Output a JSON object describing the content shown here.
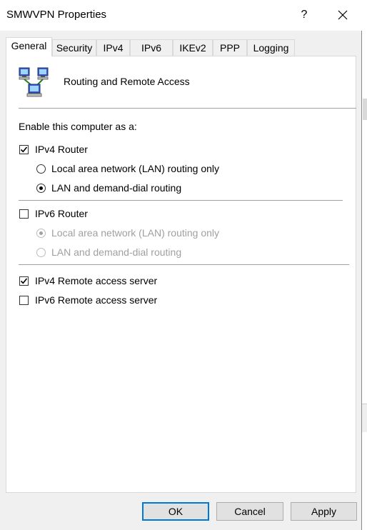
{
  "window": {
    "title": "SMWVPN Properties",
    "help_label": "?"
  },
  "tabs": [
    {
      "label": "General"
    },
    {
      "label": "Security"
    },
    {
      "label": "IPv4"
    },
    {
      "label": "IPv6"
    },
    {
      "label": "IKEv2"
    },
    {
      "label": "PPP"
    },
    {
      "label": "Logging"
    }
  ],
  "active_tab": "General",
  "general": {
    "app_icon": "network-computers-icon",
    "heading": "Routing and Remote Access",
    "enable_label": "Enable this computer as a:",
    "ipv4_router": {
      "label": "IPv4 Router",
      "checked": true,
      "options": [
        {
          "label": "Local area network (LAN) routing only",
          "selected": false
        },
        {
          "label": "LAN and demand-dial routing",
          "selected": true
        }
      ]
    },
    "ipv6_router": {
      "label": "IPv6 Router",
      "checked": false,
      "options": [
        {
          "label": "Local area network (LAN) routing only",
          "selected": true,
          "disabled": true
        },
        {
          "label": "LAN and demand-dial routing",
          "selected": false,
          "disabled": true
        }
      ]
    },
    "ipv4_remote": {
      "label": "IPv4 Remote access server",
      "checked": true
    },
    "ipv6_remote": {
      "label": "IPv6 Remote access server",
      "checked": false
    }
  },
  "buttons": {
    "ok": "OK",
    "cancel": "Cancel",
    "apply": "Apply"
  },
  "colors": {
    "accent": "#0078d7",
    "panel_bg": "#ffffff",
    "dialog_bg": "#f0f0f0",
    "disabled_text": "#a0a0a0"
  }
}
